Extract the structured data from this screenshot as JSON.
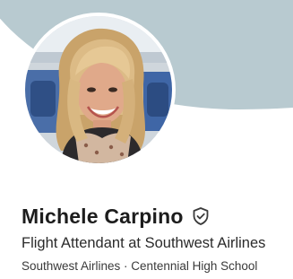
{
  "profile": {
    "name": "Michele Carpino",
    "badge_icon": "verified-shield-icon",
    "headline": "Flight Attendant at Southwest Airlines",
    "meta": "Southwest Airlines · Centennial High School"
  },
  "colors": {
    "banner": "#b8cad0",
    "text_primary": "#1d1d1d",
    "text_secondary": "#3a3a3a"
  }
}
